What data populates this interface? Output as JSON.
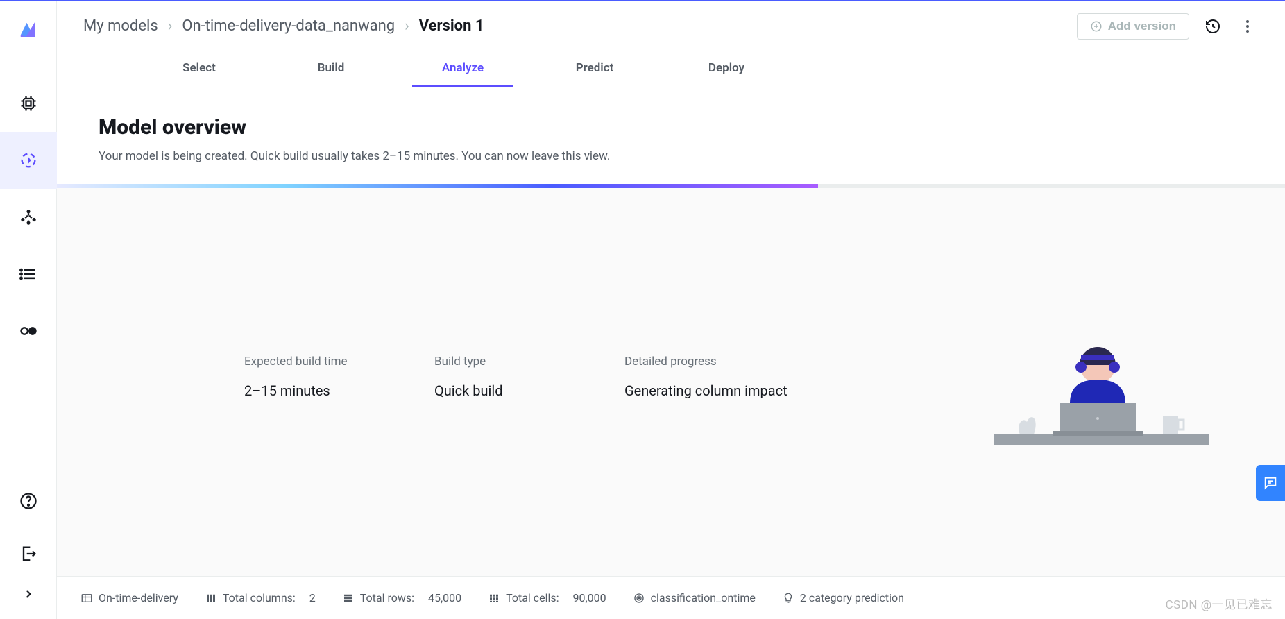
{
  "breadcrumb": {
    "root": "My models",
    "dataset": "On-time-delivery-data_nanwang",
    "version": "Version 1"
  },
  "actions": {
    "add_version": "Add version"
  },
  "tabs": {
    "select": "Select",
    "build": "Build",
    "analyze": "Analyze",
    "predict": "Predict",
    "deploy": "Deploy",
    "active": "analyze"
  },
  "overview": {
    "title": "Model overview",
    "subtitle": "Your model is being created. Quick build usually takes 2–15 minutes. You can now leave this view."
  },
  "progress": {
    "percent": 62
  },
  "stats": {
    "expected_label": "Expected build time",
    "expected_value": "2–15 minutes",
    "type_label": "Build type",
    "type_value": "Quick build",
    "detail_label": "Detailed progress",
    "detail_value": "Generating column impact"
  },
  "footer": {
    "source": "On-time-delivery",
    "columns_label": "Total columns:",
    "columns_value": "2",
    "rows_label": "Total rows:",
    "rows_value": "45,000",
    "cells_label": "Total cells:",
    "cells_value": "90,000",
    "target": "classification_ontime",
    "prediction_type": "2 category prediction"
  },
  "watermark": "CSDN @一见已难忘"
}
